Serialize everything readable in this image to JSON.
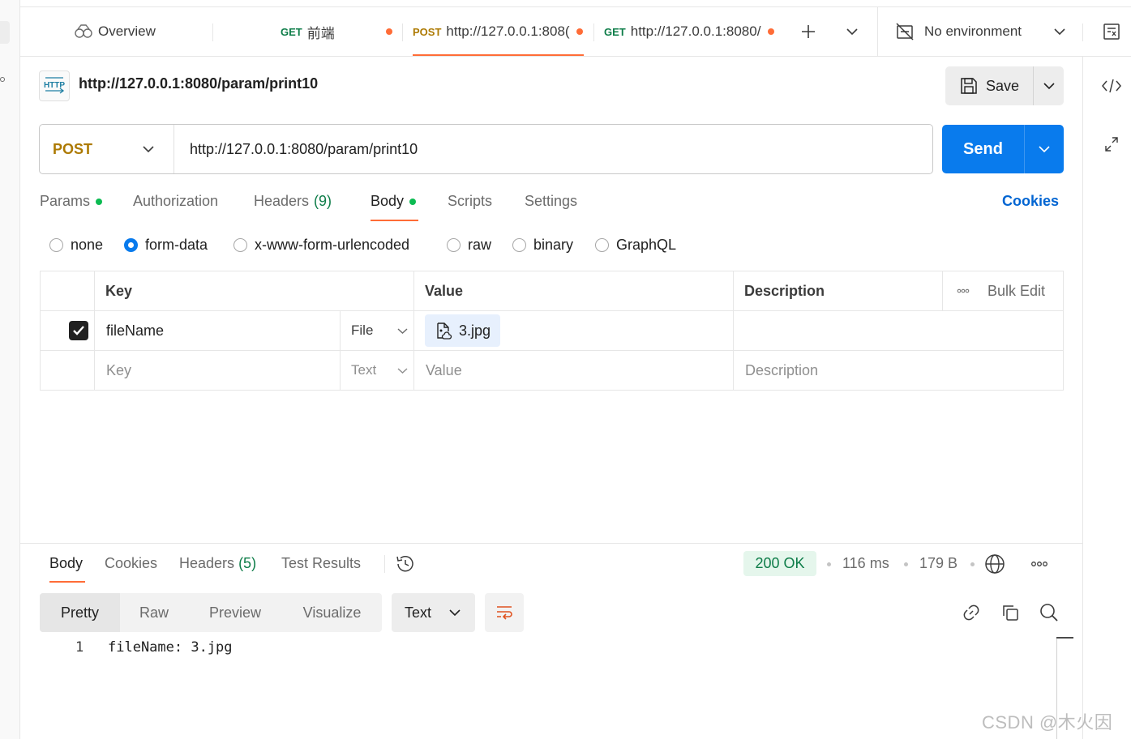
{
  "tabs": {
    "overview_label": "Overview",
    "items": [
      {
        "method": "GET",
        "title": "前端"
      },
      {
        "method": "POST",
        "title": "http://127.0.0.1:808("
      },
      {
        "method": "GET",
        "title": "http://127.0.0.1:8080/"
      }
    ],
    "environment": "No environment"
  },
  "request": {
    "title": "http://127.0.0.1:8080/param/print10",
    "badge": "HTTP",
    "method": "POST",
    "url": "http://127.0.0.1:8080/param/print10",
    "save_label": "Save",
    "send_label": "Send"
  },
  "request_tabs": {
    "params": "Params",
    "authorization": "Authorization",
    "headers": "Headers",
    "headers_count": "(9)",
    "body": "Body",
    "scripts": "Scripts",
    "settings": "Settings",
    "cookies": "Cookies"
  },
  "body_types": {
    "none": "none",
    "form_data": "form-data",
    "urlencoded": "x-www-form-urlencoded",
    "raw": "raw",
    "binary": "binary",
    "graphql": "GraphQL",
    "selected": "form-data"
  },
  "form_table": {
    "headers": {
      "key": "Key",
      "value": "Value",
      "description": "Description",
      "bulk_edit": "Bulk Edit"
    },
    "rows": [
      {
        "key": "fileName",
        "type": "File",
        "value": "3.jpg",
        "description": "",
        "checked": true
      }
    ],
    "placeholder": {
      "key": "Key",
      "type": "Text",
      "value": "Value",
      "description": "Description"
    }
  },
  "response": {
    "tabs": {
      "body": "Body",
      "cookies": "Cookies",
      "headers": "Headers",
      "headers_count": "(5)",
      "test_results": "Test Results"
    },
    "status": "200 OK",
    "time": "116 ms",
    "size": "179 B",
    "views": {
      "pretty": "Pretty",
      "raw": "Raw",
      "preview": "Preview",
      "visualize": "Visualize"
    },
    "format": "Text",
    "lines": [
      {
        "n": "1",
        "text": "fileName: 3.jpg"
      }
    ]
  },
  "watermark": "CSDN @木火因",
  "colors": {
    "accent": "#ff6c37",
    "primary": "#097bed",
    "post": "#ad7a03",
    "get": "#0e7d49"
  }
}
